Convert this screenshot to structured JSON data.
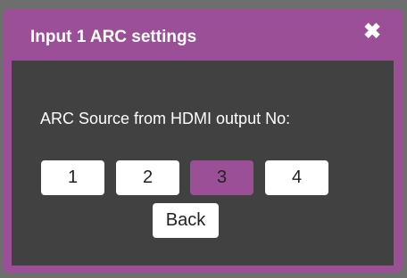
{
  "dialog": {
    "title": "Input 1 ARC settings",
    "close_icon": "close-icon",
    "close_glyph": "✖"
  },
  "arc": {
    "prompt": "ARC Source from HDMI output No:",
    "outputs": [
      "1",
      "2",
      "3",
      "4"
    ],
    "selected": "3"
  },
  "actions": {
    "back_label": "Back"
  },
  "colors": {
    "accent": "#9b4f96",
    "panel": "#414141",
    "button": "#ffffff",
    "backdrop": "#6e6e6e"
  }
}
